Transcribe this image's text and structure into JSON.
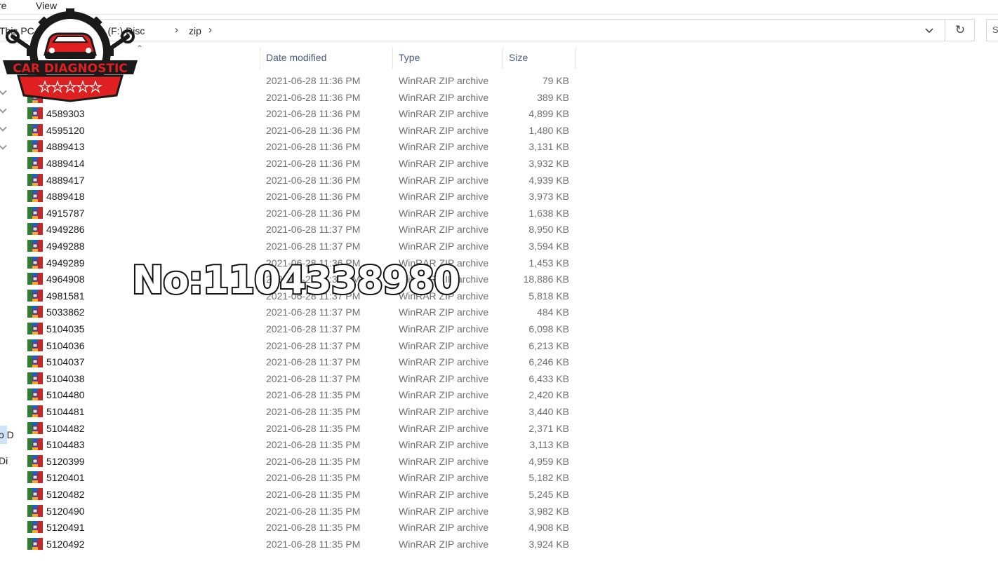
{
  "ribbon": {
    "tabs": [
      "re",
      "View"
    ]
  },
  "address": {
    "crumbs": [
      "This PC",
      "rive (F:) Disc",
      "zip"
    ]
  },
  "nav": {
    "partial_items": [
      "o D",
      "Di"
    ]
  },
  "columns": {
    "date": "Date modified",
    "type": "Type",
    "size": "Size"
  },
  "files": [
    {
      "name": "",
      "date": "2021-06-28 11:36 PM",
      "type": "WinRAR ZIP archive",
      "size": "79 KB"
    },
    {
      "name": "",
      "date": "2021-06-28 11:36 PM",
      "type": "WinRAR ZIP archive",
      "size": "389 KB"
    },
    {
      "name": "4589303",
      "date": "2021-06-28 11:36 PM",
      "type": "WinRAR ZIP archive",
      "size": "4,899 KB"
    },
    {
      "name": "4595120",
      "date": "2021-06-28 11:36 PM",
      "type": "WinRAR ZIP archive",
      "size": "1,480 KB"
    },
    {
      "name": "4889413",
      "date": "2021-06-28 11:36 PM",
      "type": "WinRAR ZIP archive",
      "size": "3,131 KB"
    },
    {
      "name": "4889414",
      "date": "2021-06-28 11:36 PM",
      "type": "WinRAR ZIP archive",
      "size": "3,932 KB"
    },
    {
      "name": "4889417",
      "date": "2021-06-28 11:36 PM",
      "type": "WinRAR ZIP archive",
      "size": "4,939 KB"
    },
    {
      "name": "4889418",
      "date": "2021-06-28 11:36 PM",
      "type": "WinRAR ZIP archive",
      "size": "3,973 KB"
    },
    {
      "name": "4915787",
      "date": "2021-06-28 11:36 PM",
      "type": "WinRAR ZIP archive",
      "size": "1,638 KB"
    },
    {
      "name": "4949286",
      "date": "2021-06-28 11:37 PM",
      "type": "WinRAR ZIP archive",
      "size": "8,950 KB"
    },
    {
      "name": "4949288",
      "date": "2021-06-28 11:37 PM",
      "type": "WinRAR ZIP archive",
      "size": "3,594 KB"
    },
    {
      "name": "4949289",
      "date": "2021-06-28 11:36 PM",
      "type": "WinRAR ZIP archive",
      "size": "1,453 KB"
    },
    {
      "name": "4964908",
      "date": "2021-06-28 11:36 PM",
      "type": "WinRAR ZIP archive",
      "size": "18,886 KB"
    },
    {
      "name": "4981581",
      "date": "2021-06-28 11:37 PM",
      "type": "WinRAR ZIP archive",
      "size": "5,818 KB"
    },
    {
      "name": "5033862",
      "date": "2021-06-28 11:37 PM",
      "type": "WinRAR ZIP archive",
      "size": "484 KB"
    },
    {
      "name": "5104035",
      "date": "2021-06-28 11:37 PM",
      "type": "WinRAR ZIP archive",
      "size": "6,098 KB"
    },
    {
      "name": "5104036",
      "date": "2021-06-28 11:37 PM",
      "type": "WinRAR ZIP archive",
      "size": "6,213 KB"
    },
    {
      "name": "5104037",
      "date": "2021-06-28 11:37 PM",
      "type": "WinRAR ZIP archive",
      "size": "6,246 KB"
    },
    {
      "name": "5104038",
      "date": "2021-06-28 11:37 PM",
      "type": "WinRAR ZIP archive",
      "size": "6,433 KB"
    },
    {
      "name": "5104480",
      "date": "2021-06-28 11:35 PM",
      "type": "WinRAR ZIP archive",
      "size": "2,420 KB"
    },
    {
      "name": "5104481",
      "date": "2021-06-28 11:35 PM",
      "type": "WinRAR ZIP archive",
      "size": "3,440 KB"
    },
    {
      "name": "5104482",
      "date": "2021-06-28 11:35 PM",
      "type": "WinRAR ZIP archive",
      "size": "2,371 KB"
    },
    {
      "name": "5104483",
      "date": "2021-06-28 11:35 PM",
      "type": "WinRAR ZIP archive",
      "size": "3,113 KB"
    },
    {
      "name": "5120399",
      "date": "2021-06-28 11:35 PM",
      "type": "WinRAR ZIP archive",
      "size": "4,959 KB"
    },
    {
      "name": "5120401",
      "date": "2021-06-28 11:35 PM",
      "type": "WinRAR ZIP archive",
      "size": "5,182 KB"
    },
    {
      "name": "5120482",
      "date": "2021-06-28 11:35 PM",
      "type": "WinRAR ZIP archive",
      "size": "5,245 KB"
    },
    {
      "name": "5120490",
      "date": "2021-06-28 11:35 PM",
      "type": "WinRAR ZIP archive",
      "size": "3,982 KB"
    },
    {
      "name": "5120491",
      "date": "2021-06-28 11:35 PM",
      "type": "WinRAR ZIP archive",
      "size": "4,908 KB"
    },
    {
      "name": "5120492",
      "date": "2021-06-28 11:35 PM",
      "type": "WinRAR ZIP archive",
      "size": "3,924 KB"
    }
  ],
  "overlay": {
    "logo_text": "CAR DIAGNOSTIC",
    "watermark": "No:1104338980"
  },
  "colors": {
    "header_text": "#4a5a78",
    "muted_text": "#707070",
    "logo_red": "#e02020",
    "logo_dark": "#1a1a1a"
  },
  "icons": {
    "file": "winrar-archive-icon",
    "refresh": "refresh-icon",
    "dropdown": "chevron-down-icon",
    "sort": "sort-up-icon"
  }
}
